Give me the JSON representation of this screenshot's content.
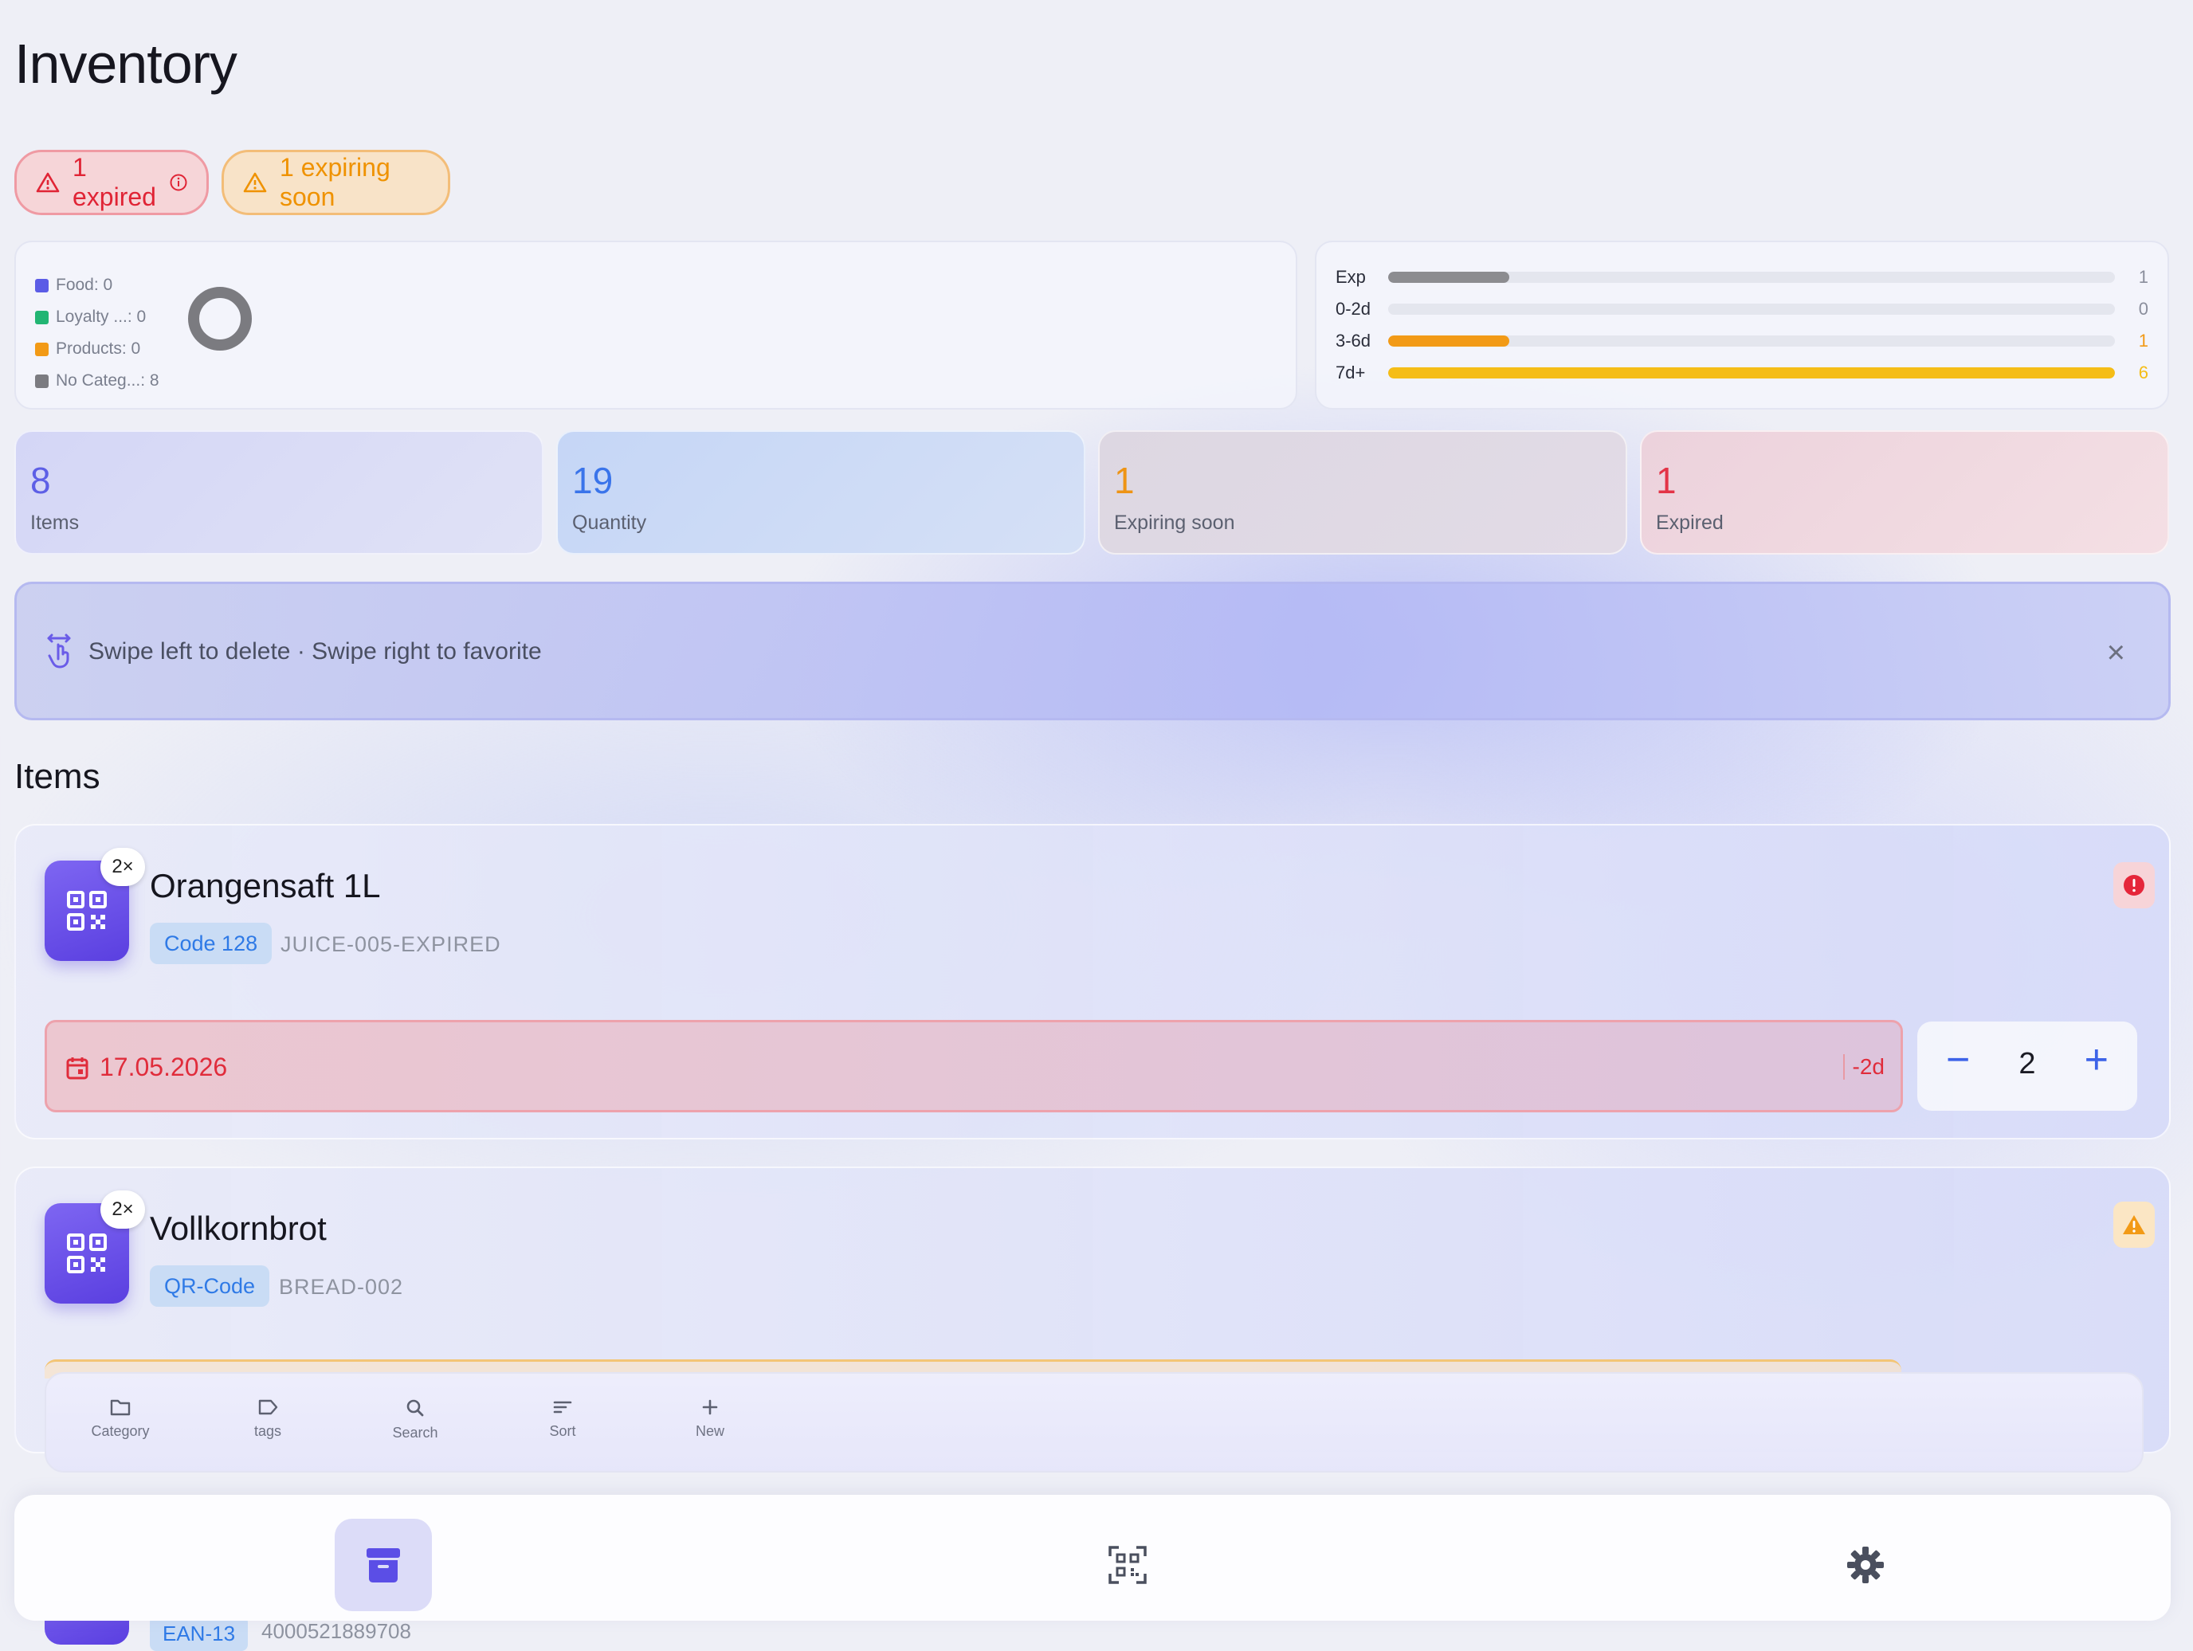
{
  "page_title": "Inventory",
  "alerts": {
    "expired": "1 expired",
    "expiring_soon": "1 expiring soon"
  },
  "categories": {
    "legend": [
      {
        "label": "Food: 0",
        "color": "#5b5ce6"
      },
      {
        "label": "Loyalty ...: 0",
        "color": "#22b573"
      },
      {
        "label": "Products: 0",
        "color": "#f29a16"
      },
      {
        "label": "No Categ...: 8",
        "color": "#7b7b80"
      }
    ]
  },
  "expiry": {
    "rows": [
      {
        "label": "Exp",
        "count": "1",
        "fraction": 0.167,
        "color": "#8c8c90",
        "count_color": "#8a8e9c"
      },
      {
        "label": "0-2d",
        "count": "0",
        "fraction": 0,
        "color": "#e4e6ee",
        "count_color": "#8a8e9c"
      },
      {
        "label": "3-6d",
        "count": "1",
        "fraction": 0.167,
        "color": "#f29a16",
        "count_color": "#f29a16"
      },
      {
        "label": "7d+",
        "count": "6",
        "fraction": 1.0,
        "color": "#f5bd16",
        "count_color": "#f5bd16"
      }
    ]
  },
  "stats": [
    {
      "value": "8",
      "label": "Items"
    },
    {
      "value": "19",
      "label": "Quantity"
    },
    {
      "value": "1",
      "label": "Expiring soon"
    },
    {
      "value": "1",
      "label": "Expired"
    }
  ],
  "tip": {
    "text": "Swipe left to delete · Swipe right to favorite",
    "close": "×"
  },
  "section_title": "Items",
  "items": [
    {
      "name": "Orangensaft 1L",
      "count_badge": "2×",
      "code_type": "Code 128",
      "code_value": "JUICE-005-EXPIRED",
      "status": "expired",
      "date": "17.05.2026",
      "days": "-2d",
      "quantity": "2"
    },
    {
      "name": "Vollkornbrot",
      "count_badge": "2×",
      "code_type": "QR-Code",
      "code_value": "BREAD-002",
      "status": "warning"
    },
    {
      "code_type": "EAN-13",
      "code_value": "4000521889708"
    }
  ],
  "quantity_controls": {
    "minus": "−",
    "plus": "+"
  },
  "toolbar": [
    {
      "label": "Category",
      "icon": "folder-icon"
    },
    {
      "label": "tags",
      "icon": "tag-icon"
    },
    {
      "label": "Search",
      "icon": "search-icon"
    },
    {
      "label": "Sort",
      "icon": "sort-icon"
    },
    {
      "label": "New",
      "icon": "plus-icon"
    }
  ],
  "tabs": [
    {
      "icon": "archive-box-icon",
      "active": true
    },
    {
      "icon": "qr-scan-icon",
      "active": false
    },
    {
      "icon": "gear-icon",
      "active": false
    }
  ]
}
